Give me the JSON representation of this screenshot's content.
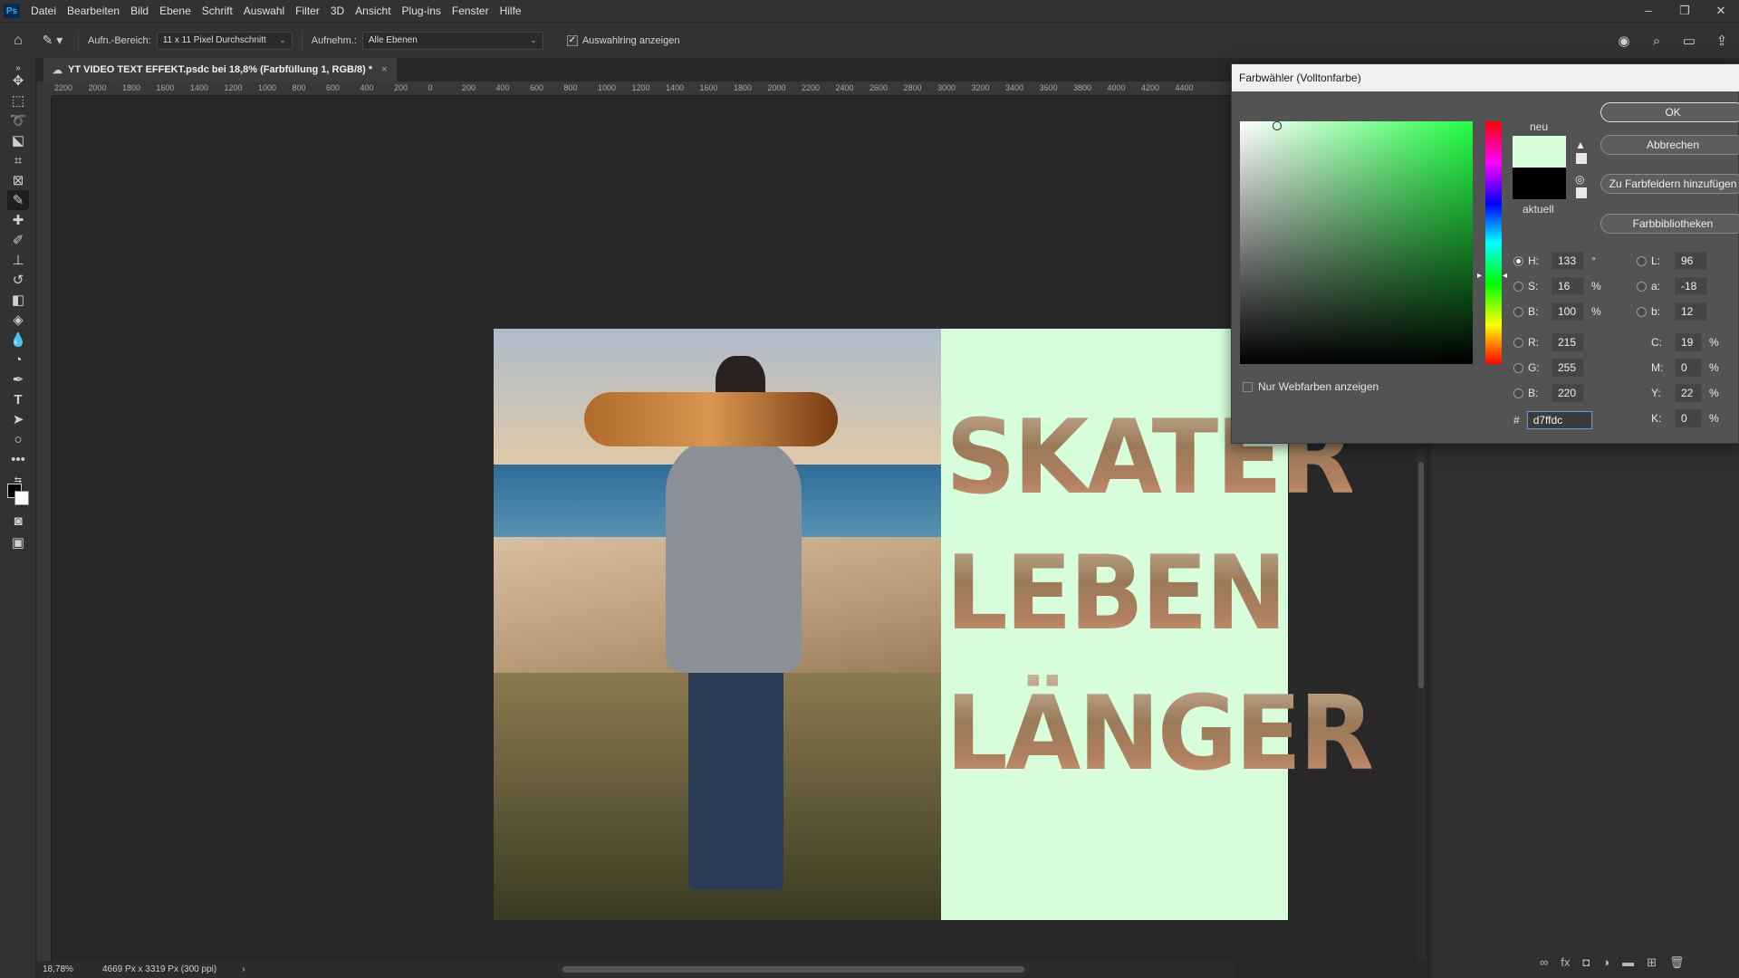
{
  "menubar": {
    "logo": "Ps",
    "items": [
      "Datei",
      "Bearbeiten",
      "Bild",
      "Ebene",
      "Schrift",
      "Auswahl",
      "Filter",
      "3D",
      "Ansicht",
      "Plug-ins",
      "Fenster",
      "Hilfe"
    ],
    "window_controls": [
      "–",
      "❐",
      "✕"
    ]
  },
  "options": {
    "sample_size_label": "Aufn.-Bereich:",
    "sample_size_value": "11 x 11 Pixel Durchschnitt",
    "sample_label": "Aufnehm.:",
    "sample_value": "Alle Ebenen",
    "show_ring_label": "Auswahlring anzeigen",
    "show_ring_checked": true
  },
  "document": {
    "tab_title": "YT VIDEO TEXT EFFEKT.psdc bei 18,8% (Farbfüllung 1, RGB/8) *",
    "close": "×",
    "words": [
      "SKATER",
      "LEBEN",
      "LÄNGER"
    ],
    "panel_color": "#d7ffdc"
  },
  "ruler": {
    "top_ticks": [
      "2200",
      "2000",
      "1800",
      "1600",
      "1400",
      "1200",
      "1000",
      "800",
      "600",
      "400",
      "200",
      "0",
      "200",
      "400",
      "600",
      "800",
      "1000",
      "1200",
      "1400",
      "1600",
      "1800",
      "2000",
      "2200",
      "2400",
      "2600",
      "2800",
      "3000",
      "3200",
      "3400",
      "3600",
      "3800",
      "4000",
      "4200",
      "4400"
    ]
  },
  "status": {
    "zoom": "18,78%",
    "doc_size": "4669 Px x 3319 Px (300 ppi)",
    "arrow": "›"
  },
  "picker": {
    "title": "Farbwähler (Volltonfarbe)",
    "new_label": "neu",
    "current_label": "aktuell",
    "new_color": "#d7ffdc",
    "current_color": "#000000",
    "buttons": {
      "ok": "OK",
      "cancel": "Abbrechen",
      "add_swatch": "Zu Farbfeldern hinzufügen",
      "libraries": "Farbbibliotheken"
    },
    "web_only_label": "Nur Webfarben anzeigen",
    "hsb": {
      "h_label": "H:",
      "h": "133",
      "h_unit": "°",
      "s_label": "S:",
      "s": "16",
      "s_unit": "%",
      "b_label": "B:",
      "b": "100",
      "b_unit": "%"
    },
    "rgb": {
      "r_label": "R:",
      "r": "215",
      "g_label": "G:",
      "g": "255",
      "b_label": "B:",
      "b": "220"
    },
    "lab": {
      "l_label": "L:",
      "l": "96",
      "a_label": "a:",
      "a": "-18",
      "b_label": "b:",
      "b": "12"
    },
    "cmyk": {
      "c_label": "C:",
      "c": "19",
      "c_unit": "%",
      "m_label": "M:",
      "m": "0",
      "m_unit": "%",
      "y_label": "Y:",
      "y": "22",
      "y_unit": "%",
      "k_label": "K:",
      "k": "0",
      "k_unit": "%"
    },
    "hex_label": "#",
    "hex": "d7ffdc"
  }
}
